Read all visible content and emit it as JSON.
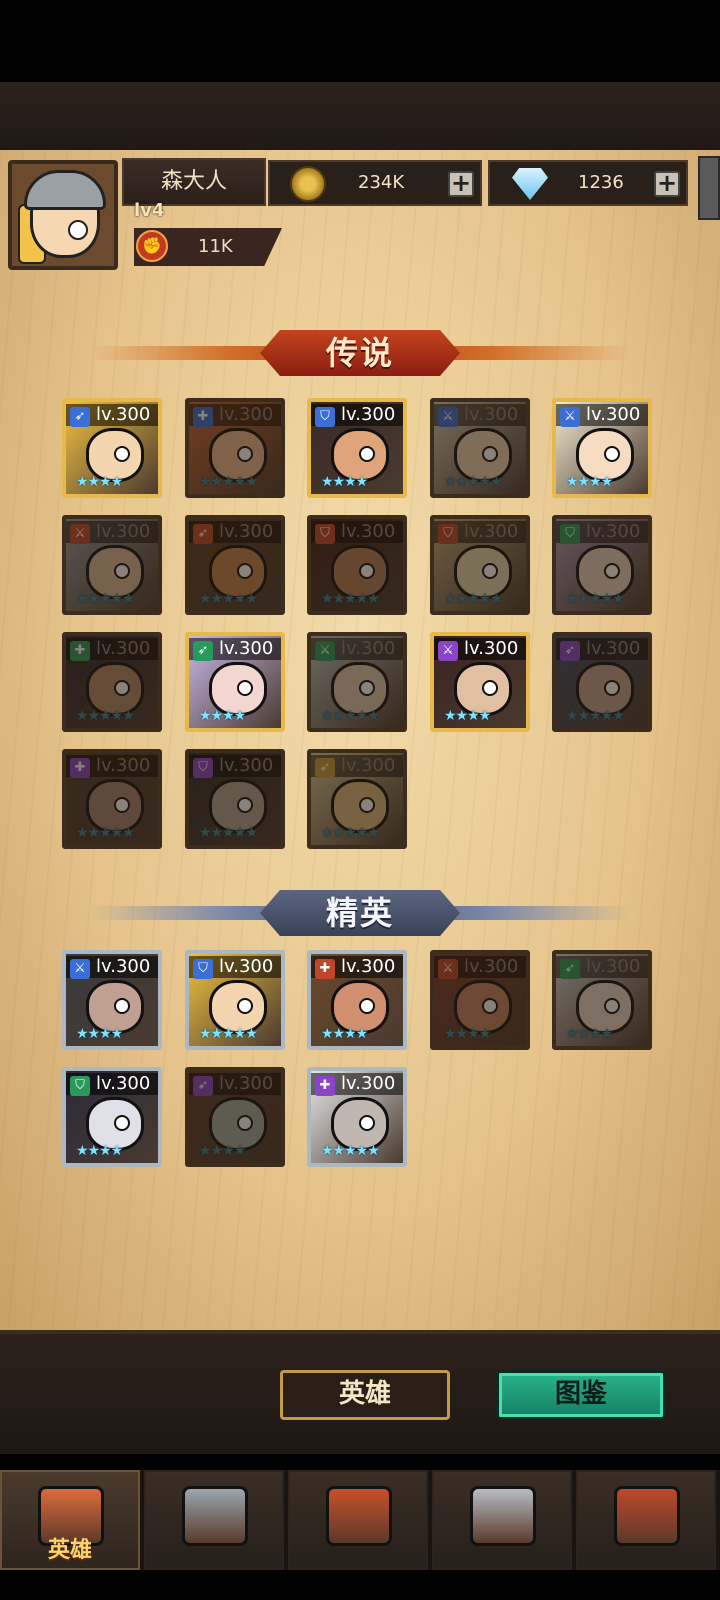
{
  "player": {
    "name": "森大人",
    "level": "lv4",
    "power": "11K"
  },
  "resources": {
    "gold": "234K",
    "diamonds": "1236",
    "plus": "+"
  },
  "sections": {
    "legend": "传说",
    "elite": "精英"
  },
  "legend_heroes": [
    {
      "level": "lv.300",
      "stars": "★★★★",
      "class": "blue",
      "icon": "bow-icon",
      "frame": "gold",
      "owned": true,
      "skin": "#f3d6b0",
      "hair": "#f0c040"
    },
    {
      "level": "lv.300",
      "stars": "★★★★★",
      "class": "blue",
      "icon": "cross-icon",
      "frame": "bronze",
      "owned": false,
      "skin": "#e8b890",
      "hair": "#d06a3a"
    },
    {
      "level": "lv.300",
      "stars": "★★★★",
      "class": "blue",
      "icon": "shield-icon",
      "frame": "gold",
      "owned": true,
      "skin": "#e0a47a",
      "hair": "#3a2a24"
    },
    {
      "level": "lv.300",
      "stars": "★★★★★",
      "class": "blue",
      "icon": "sword-icon",
      "frame": "bronze",
      "owned": false,
      "skin": "#e8d0b0",
      "hair": "#d8d0c0"
    },
    {
      "level": "lv.300",
      "stars": "★★★★",
      "class": "blue",
      "icon": "sword-icon",
      "frame": "gold",
      "owned": true,
      "skin": "#f6dcc0",
      "hair": "#f3ead0"
    },
    {
      "level": "lv.300",
      "stars": "★★★★★",
      "class": "red",
      "icon": "sword-icon",
      "frame": "bronze",
      "owned": false,
      "skin": "#d6b89a",
      "hair": "#9aa0a6"
    },
    {
      "level": "lv.300",
      "stars": "★★★★★",
      "class": "red",
      "icon": "bow-icon",
      "frame": "bronze",
      "owned": false,
      "skin": "#c08050",
      "hair": "#5a3a20"
    },
    {
      "level": "lv.300",
      "stars": "★★★★★",
      "class": "red",
      "icon": "shield-icon",
      "frame": "bronze",
      "owned": false,
      "skin": "#b07a58",
      "hair": "#3a2018"
    },
    {
      "level": "lv.300",
      "stars": "★★★★★",
      "class": "red",
      "icon": "shield-icon",
      "frame": "bronze",
      "owned": false,
      "skin": "#e0d6b0",
      "hair": "#c0b080"
    },
    {
      "level": "lv.300",
      "stars": "★★★★★",
      "class": "green",
      "icon": "shield-icon",
      "frame": "bronze",
      "owned": false,
      "skin": "#e6d0c0",
      "hair": "#b0a0c0"
    },
    {
      "level": "lv.300",
      "stars": "★★★★★",
      "class": "green",
      "icon": "cross-icon",
      "frame": "bronze",
      "owned": false,
      "skin": "#b08868",
      "hair": "#2a2630"
    },
    {
      "level": "lv.300",
      "stars": "★★★★",
      "class": "green",
      "icon": "bow-icon",
      "frame": "gold",
      "owned": true,
      "skin": "#f3d6d0",
      "hair": "#c8b8e8"
    },
    {
      "level": "lv.300",
      "stars": "★★★★★",
      "class": "green",
      "icon": "sword-icon",
      "frame": "bronze",
      "owned": false,
      "skin": "#e0c8b0",
      "hair": "#c0c8c8"
    },
    {
      "level": "lv.300",
      "stars": "★★★★",
      "class": "purple",
      "icon": "sword-icon",
      "frame": "gold",
      "owned": true,
      "skin": "#e0c0a0",
      "hair": "#3a2420"
    },
    {
      "level": "lv.300",
      "stars": "★★★★★",
      "class": "purple",
      "icon": "bow-icon",
      "frame": "bronze",
      "owned": false,
      "skin": "#c0a090",
      "hair": "#3a4a6a"
    },
    {
      "level": "lv.300",
      "stars": "★★★★★",
      "class": "purple",
      "icon": "cross-icon",
      "frame": "bronze",
      "owned": false,
      "skin": "#a08070",
      "hair": "#4a3a2a"
    },
    {
      "level": "lv.300",
      "stars": "★★★★★",
      "class": "purple",
      "icon": "shield-icon",
      "frame": "bronze",
      "owned": false,
      "skin": "#b0a090",
      "hair": "#2a2a2a"
    },
    {
      "level": "lv.300",
      "stars": "★★★★★",
      "class": "gold",
      "icon": "bow-icon",
      "frame": "bronze",
      "owned": false,
      "skin": "#d8b880",
      "hair": "#e0d0a0"
    }
  ],
  "elite_heroes": [
    {
      "level": "lv.300",
      "stars": "★★★★",
      "class": "blue",
      "icon": "sword-icon",
      "frame": "silver",
      "owned": true,
      "skin": "#c0a090",
      "hair": "#3a3a3a"
    },
    {
      "level": "lv.300",
      "stars": "★★★★★",
      "class": "blue",
      "icon": "shield-icon",
      "frame": "silver",
      "owned": true,
      "skin": "#f3d6b0",
      "hair": "#f0c040"
    },
    {
      "level": "lv.300",
      "stars": "★★★★",
      "class": "red",
      "icon": "cross-icon",
      "frame": "silver",
      "owned": true,
      "skin": "#d09070",
      "hair": "#6a4a2a"
    },
    {
      "level": "lv.300",
      "stars": "★★★★",
      "class": "red",
      "icon": "sword-icon",
      "frame": "bronze",
      "owned": false,
      "skin": "#c08060",
      "hair": "#7a3a2a"
    },
    {
      "level": "lv.300",
      "stars": "★★★★",
      "class": "green",
      "icon": "bow-icon",
      "frame": "bronze",
      "owned": false,
      "skin": "#e6d6c8",
      "hair": "#d8d8d8"
    },
    {
      "level": "lv.300",
      "stars": "★★★★",
      "class": "green",
      "icon": "shield-icon",
      "frame": "silver",
      "owned": true,
      "skin": "#e0e0e8",
      "hair": "#2a2a3a"
    },
    {
      "level": "lv.300",
      "stars": "★★★★",
      "class": "purple",
      "icon": "bow-icon",
      "frame": "bronze",
      "owned": false,
      "skin": "#a0a8a0",
      "hair": "#5a3a2a"
    },
    {
      "level": "lv.300",
      "stars": "★★★★★",
      "class": "purple",
      "icon": "cross-icon",
      "frame": "silver",
      "owned": true,
      "skin": "#c0b8b0",
      "hair": "#e8e8e8"
    }
  ],
  "tabs": {
    "heroes": "英雄",
    "codex": "图鉴"
  },
  "nav": [
    {
      "label": "英雄",
      "icon": "helmet-icon",
      "active": true
    },
    {
      "label": "",
      "icon": "flag-icon",
      "active": false
    },
    {
      "label": "",
      "icon": "battle-icon",
      "active": false
    },
    {
      "label": "",
      "icon": "castle-icon",
      "active": false
    },
    {
      "label": "",
      "icon": "guild-icon",
      "active": false
    }
  ],
  "colors": {
    "blue": "#3b6fd6",
    "red": "#c0462a",
    "green": "#2a9a5a",
    "purple": "#8a44c8",
    "gold": "#c89a3a",
    "accent_teal": "#2ab38a"
  }
}
